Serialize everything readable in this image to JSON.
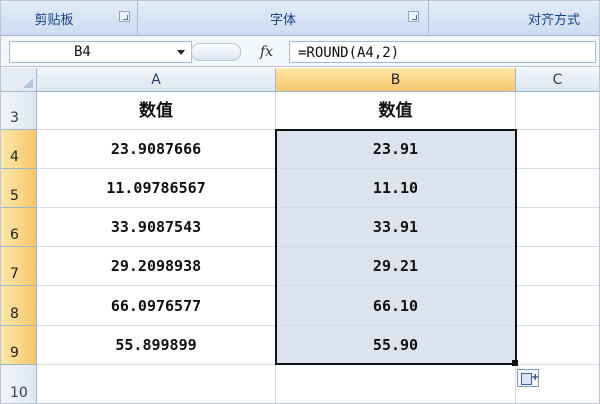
{
  "ribbon": {
    "clipboard_label": "剪贴板",
    "font_label": "字体",
    "alignment_label": "对齐方式"
  },
  "formula_bar": {
    "name_box": "B4",
    "fx_label": "fx",
    "formula": "=ROUND(A4,2)"
  },
  "columns": [
    {
      "label": "A",
      "selected": false
    },
    {
      "label": "B",
      "selected": true
    },
    {
      "label": "C",
      "selected": false
    }
  ],
  "rows": [
    {
      "num": "3",
      "selected": false,
      "a": "数值",
      "b": "数值"
    },
    {
      "num": "4",
      "selected": true,
      "a": "23.9087666",
      "b": "23.91"
    },
    {
      "num": "5",
      "selected": true,
      "a": "11.09786567",
      "b": "11.10"
    },
    {
      "num": "6",
      "selected": true,
      "a": "33.9087543",
      "b": "33.91"
    },
    {
      "num": "7",
      "selected": true,
      "a": "29.2098938",
      "b": "29.21"
    },
    {
      "num": "8",
      "selected": true,
      "a": "66.0976577",
      "b": "66.10"
    },
    {
      "num": "9",
      "selected": true,
      "a": "55.899899",
      "b": "55.90"
    },
    {
      "num": "10",
      "selected": false,
      "a": "",
      "b": ""
    }
  ],
  "colors": {
    "selection_fill": "#dde4ef",
    "header_highlight": "#f8c86e",
    "ribbon_text": "#15428b"
  },
  "icons": [
    "dialog-launcher-icon",
    "name-box-dropdown-icon",
    "fx-icon",
    "paste-options-icon"
  ]
}
